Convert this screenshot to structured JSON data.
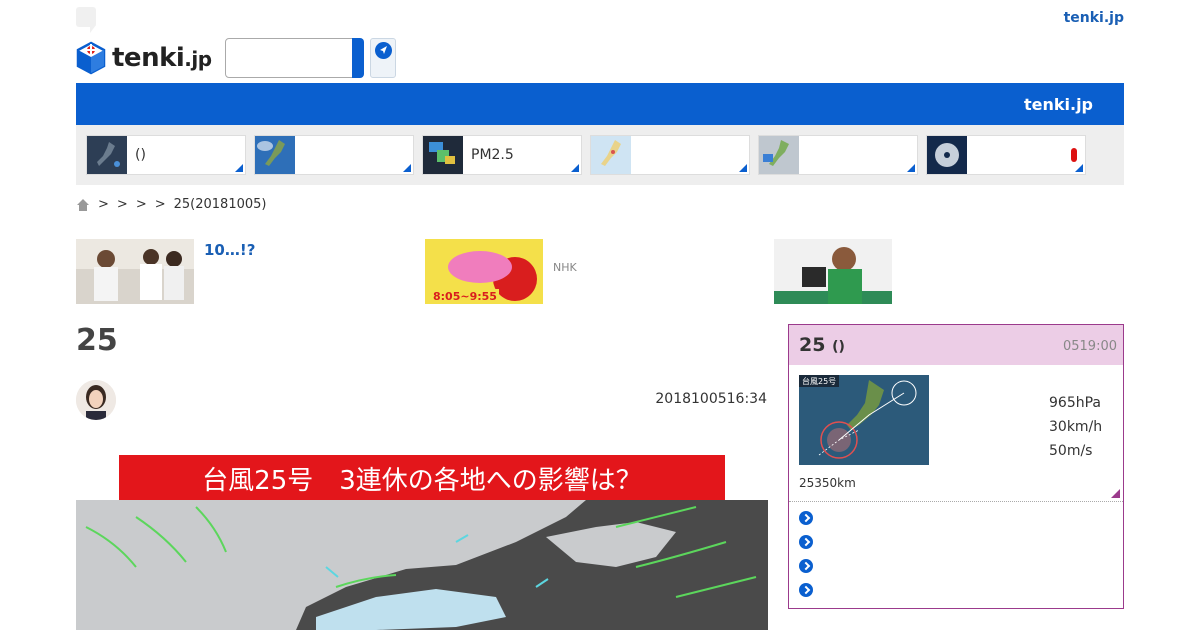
{
  "header": {
    "top_link": "tenki.jp",
    "logo_text": "tenki",
    "logo_suffix": ".jp",
    "search_placeholder": "",
    "bluebar_label": "tenki.jp"
  },
  "tiles": [
    {
      "label": "()",
      "icon": "japan-radar-thumb"
    },
    {
      "label": "",
      "icon": "japan-satellite-thumb"
    },
    {
      "label": "PM2.5",
      "icon": "pm25-map-thumb"
    },
    {
      "label": "",
      "icon": "japan-map-thumb"
    },
    {
      "label": "",
      "icon": "rain-radar-thumb"
    },
    {
      "label": "",
      "icon": "typhoon-satellite-thumb"
    }
  ],
  "breadcrumb": {
    "separator": ">",
    "current": "25(20181005)"
  },
  "promos": [
    {
      "title": "10…!?",
      "note": ""
    },
    {
      "title": "",
      "note": "NHK"
    },
    {
      "title": "",
      "note": ""
    }
  ],
  "article": {
    "title": "25",
    "datetime": "2018100516:34",
    "hero_caption": "台風25号　3連休の各地への影響は？"
  },
  "sidebar": {
    "title": "25",
    "title_suffix": "()",
    "time": "0519:00",
    "pressure": "965hPa",
    "speed": "30km/h",
    "gust": "50m/s",
    "distance": "25350km",
    "map_label": "台風25号"
  },
  "colors": {
    "brand_blue": "#0a5fcf",
    "typhoon_purple": "#9b3a8c",
    "typhoon_pink": "#eccde6",
    "hero_red": "#e3161b"
  }
}
